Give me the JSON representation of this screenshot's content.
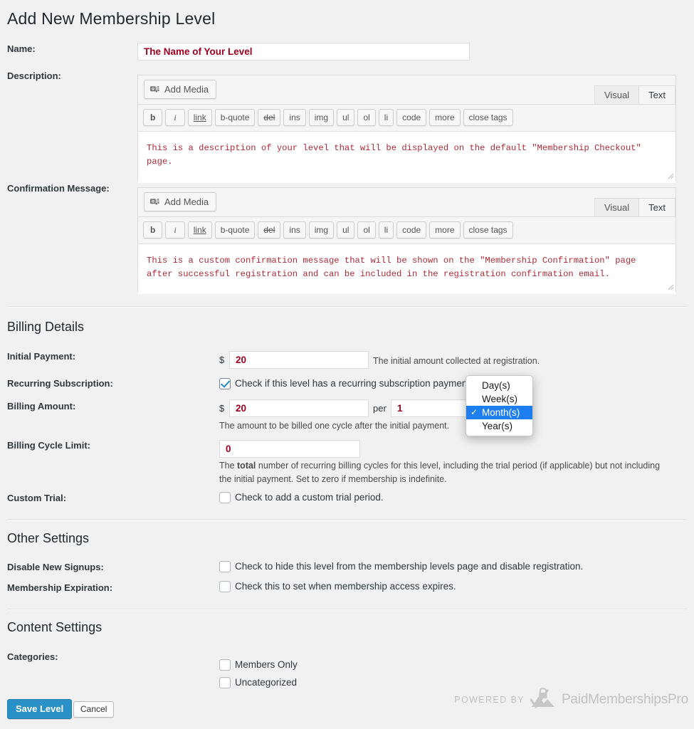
{
  "page": {
    "title": "Add New Membership Level"
  },
  "fields": {
    "name_label": "Name:",
    "name_value": "The Name of Your Level",
    "description_label": "Description:",
    "confirmation_label": "Confirmation Message:"
  },
  "editor": {
    "add_media_label": "Add Media",
    "add_media_icon": "media-camera-note-icon",
    "tabs": [
      {
        "label": "Visual",
        "active": false
      },
      {
        "label": "Text",
        "active": true
      }
    ],
    "quicktags": [
      "b",
      "i",
      "link",
      "b-quote",
      "del",
      "ins",
      "img",
      "ul",
      "ol",
      "li",
      "code",
      "more",
      "close tags"
    ],
    "description_content": "This is a description of your level that will be displayed on the default \"Membership Checkout\" page.",
    "confirmation_content": "This is a custom confirmation message that will be shown on the \"Membership Confirmation\" page after successful registration and can be included in the registration confirmation email."
  },
  "billing": {
    "heading": "Billing Details",
    "initial_payment_label": "Initial Payment:",
    "initial_payment_currency": "$",
    "initial_payment_value": "20",
    "initial_payment_hint": "The initial amount collected at registration.",
    "recurring_label": "Recurring Subscription:",
    "recurring_checkbox_label": "Check if this level has a recurring subscription payment.",
    "recurring_checked": true,
    "billing_amount_label": "Billing Amount:",
    "billing_amount_currency": "$",
    "billing_amount_value": "20",
    "per_label": "per",
    "cycle_number_value": "1",
    "cycle_period_options": [
      "Day(s)",
      "Week(s)",
      "Month(s)",
      "Year(s)"
    ],
    "cycle_period_selected": "Month(s)",
    "billing_amount_hint": "The amount to be billed one cycle after the initial payment.",
    "cycle_limit_label": "Billing Cycle Limit:",
    "cycle_limit_value": "0",
    "cycle_limit_hint_1": "The ",
    "cycle_limit_hint_bold": "total",
    "cycle_limit_hint_2": " number of recurring billing cycles for this level, including the trial period (if applicable) but not including the initial payment. Set to zero if membership is indefinite.",
    "custom_trial_label": "Custom Trial:",
    "custom_trial_checkbox_label": "Check to add a custom trial period.",
    "custom_trial_checked": false
  },
  "other": {
    "heading": "Other Settings",
    "disable_signups_label": "Disable New Signups:",
    "disable_signups_checkbox_label": "Check to hide this level from the membership levels page and disable registration.",
    "disable_signups_checked": false,
    "expiration_label": "Membership Expiration:",
    "expiration_checkbox_label": "Check this to set when membership access expires.",
    "expiration_checked": false
  },
  "content": {
    "heading": "Content Settings",
    "categories_label": "Categories:",
    "categories": [
      {
        "label": "Members Only",
        "checked": false
      },
      {
        "label": "Uncategorized",
        "checked": false
      }
    ]
  },
  "footer": {
    "save_label": "Save Level",
    "cancel_label": "Cancel",
    "powered_by": "POWERED BY",
    "brand": "PaidMembershipsPro",
    "brand_icon": "pmpro-mountain-checkmark-icon"
  },
  "colors": {
    "background": "#f1f1f1",
    "input_text": "#a00020",
    "editor_text": "#b02a37",
    "primary_button": "#2a91c6",
    "select_highlight": "#1e7ef0",
    "heading": "#23282d"
  }
}
